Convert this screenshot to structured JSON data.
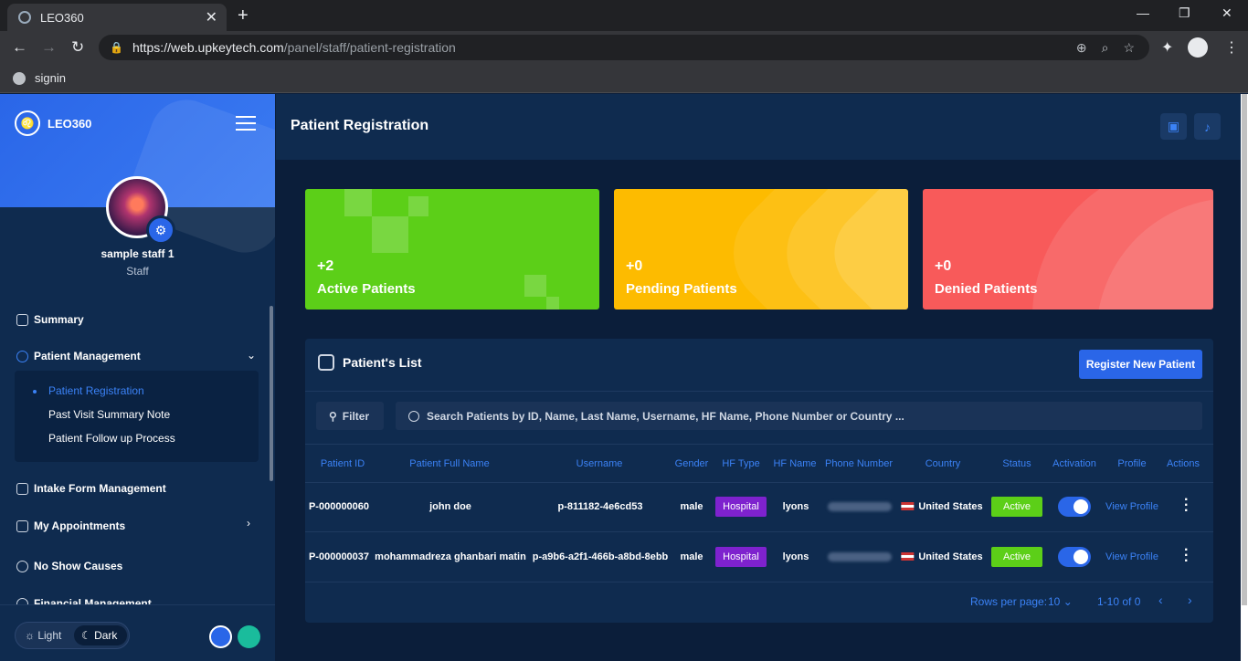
{
  "browser": {
    "tab_title": "LEO360",
    "new_tab": "+",
    "tab_close": "✕",
    "url_host": "https://web.upkeytech.com",
    "url_path": "/panel/staff/patient-registration",
    "bookmark": "signin"
  },
  "sidebar": {
    "brand": "LEO360",
    "user_name": "sample staff 1",
    "user_role": "Staff",
    "menu": [
      {
        "label": "Summary"
      },
      {
        "label": "Patient Management"
      },
      {
        "label": "Intake Form Management"
      },
      {
        "label": "My Appointments"
      },
      {
        "label": "No Show Causes"
      },
      {
        "label": "Financial Management"
      }
    ],
    "submenu": [
      {
        "label": "Patient Registration"
      },
      {
        "label": "Past Visit Summary Note"
      },
      {
        "label": "Patient Follow up Process"
      }
    ],
    "theme_light": "Light",
    "theme_dark": "Dark",
    "accent_colors": [
      "#2a66e8",
      "#1abc9c"
    ]
  },
  "header": {
    "title": "Patient Registration"
  },
  "cards": [
    {
      "value": "+2",
      "label": "Active Patients",
      "color": "#5ccf18"
    },
    {
      "value": "+0",
      "label": "Pending Patients",
      "color": "#fdbb00"
    },
    {
      "value": "+0",
      "label": "Denied Patients",
      "color": "#f85a5a"
    }
  ],
  "patients": {
    "title": "Patient's List",
    "register_button": "Register New Patient",
    "filter_label": "Filter",
    "search_placeholder": "Search Patients by ID, Name, Last Name, Username, HF Name, Phone Number or Country ...",
    "columns": [
      "Patient ID",
      "Patient Full Name",
      "Username",
      "Gender",
      "HF Type",
      "HF Name",
      "Phone Number",
      "Country",
      "Status",
      "Activation",
      "Profile",
      "Actions"
    ],
    "rows": [
      {
        "id": "P-000000060",
        "name": "john doe",
        "username": "p-811182-4e6cd53",
        "gender": "male",
        "hf_type": "Hospital",
        "hf_name": "lyons",
        "country": "United States",
        "status": "Active",
        "activation": true,
        "profile": "View Profile"
      },
      {
        "id": "P-000000037",
        "name": "mohammadreza ghanbari matin",
        "username": "p-a9b6-a2f1-466b-a8bd-8ebb",
        "gender": "male",
        "hf_type": "Hospital",
        "hf_name": "lyons",
        "country": "United States",
        "status": "Active",
        "activation": true,
        "profile": "View Profile"
      }
    ],
    "rows_per_page_label": "Rows per page:",
    "rows_per_page": "10",
    "range": "1-10 of 0"
  }
}
